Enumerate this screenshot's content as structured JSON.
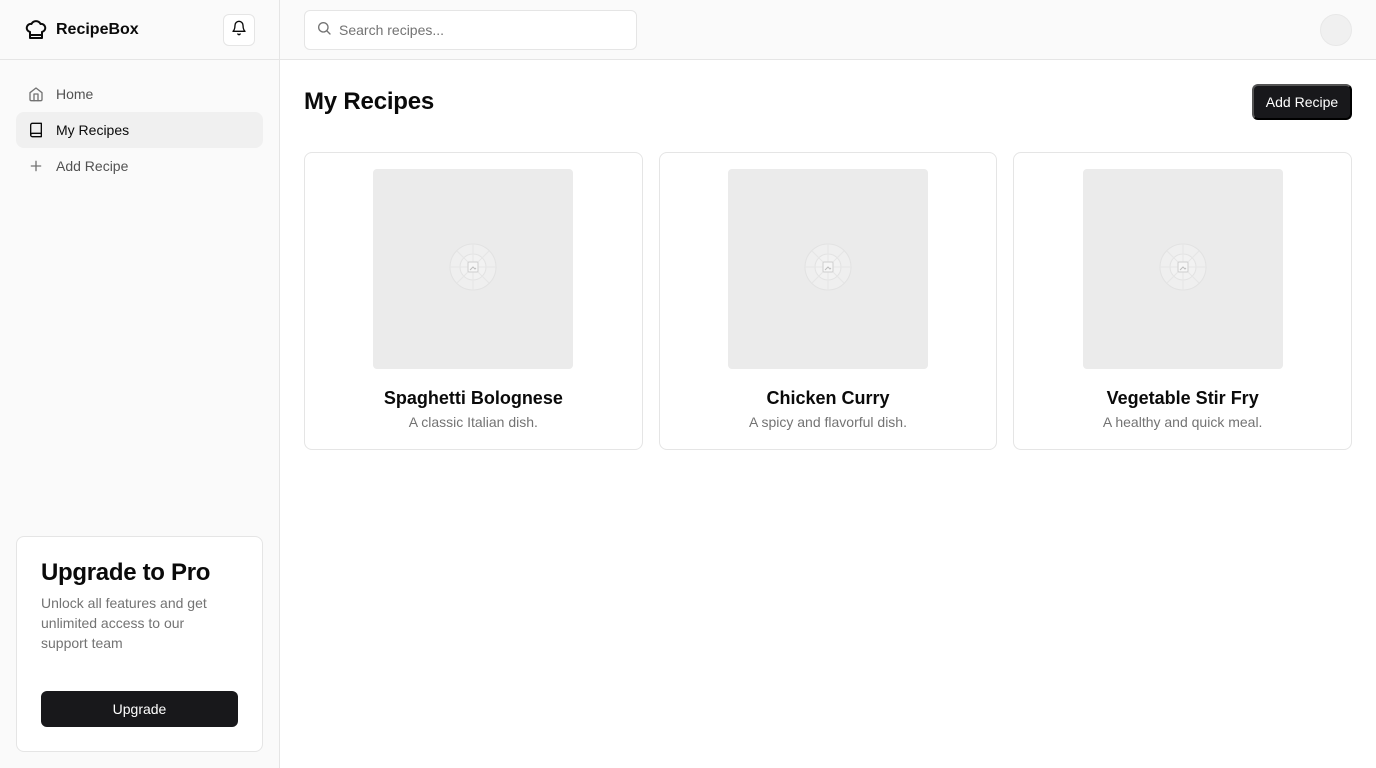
{
  "app": {
    "name": "RecipeBox"
  },
  "search": {
    "placeholder": "Search recipes..."
  },
  "sidebar": {
    "items": [
      {
        "label": "Home",
        "icon": "home-icon",
        "active": false
      },
      {
        "label": "My Recipes",
        "icon": "book-icon",
        "active": true
      },
      {
        "label": "Add Recipe",
        "icon": "plus-icon",
        "active": false
      }
    ]
  },
  "upgrade": {
    "title": "Upgrade to Pro",
    "description": "Unlock all features and get unlimited access to our support team",
    "button_label": "Upgrade"
  },
  "main": {
    "title": "My Recipes",
    "add_button_label": "Add Recipe"
  },
  "recipes": [
    {
      "title": "Spaghetti Bolognese",
      "description": "A classic Italian dish."
    },
    {
      "title": "Chicken Curry",
      "description": "A spicy and flavorful dish."
    },
    {
      "title": "Vegetable Stir Fry",
      "description": "A healthy and quick meal."
    }
  ],
  "colors": {
    "primary": "#18181b",
    "muted_text": "#737373",
    "sidebar_bg": "#fafafa",
    "border": "#e5e5e5",
    "placeholder_bg": "#ebebeb"
  }
}
